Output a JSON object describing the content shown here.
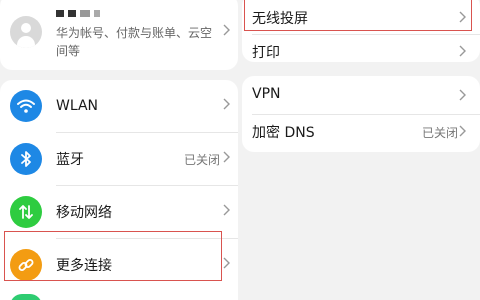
{
  "left": {
    "account": {
      "description": "华为帐号、付款与账单、云空间等"
    },
    "items": [
      {
        "label": "WLAN",
        "status": "",
        "icon": "wifi-icon",
        "color": "#1e88e5"
      },
      {
        "label": "蓝牙",
        "status": "已关闭",
        "icon": "bluetooth-icon",
        "color": "#1e88e5"
      },
      {
        "label": "移动网络",
        "status": "",
        "icon": "mobile-data-icon",
        "color": "#2ecc40"
      },
      {
        "label": "更多连接",
        "status": "",
        "icon": "link-icon",
        "color": "#f39c12"
      }
    ]
  },
  "right": {
    "group1": [
      {
        "label": "无线投屏",
        "status": ""
      },
      {
        "label": "打印",
        "status": ""
      }
    ],
    "group2": [
      {
        "label": "VPN",
        "status": ""
      },
      {
        "label": "加密 DNS",
        "status": "已关闭"
      }
    ]
  },
  "colors": {
    "highlight": "#d9534f",
    "blue": "#1e88e5",
    "green": "#2ecc40",
    "orange": "#f39c12"
  }
}
